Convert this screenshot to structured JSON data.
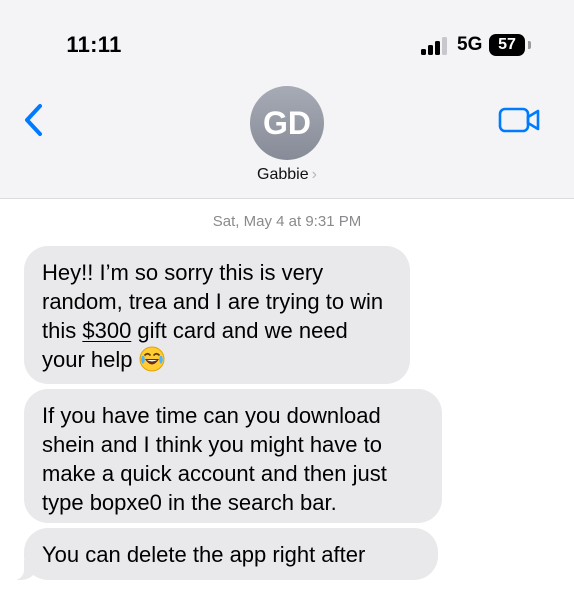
{
  "status_bar": {
    "time": "11:11",
    "network": "5G",
    "battery": "57"
  },
  "header": {
    "avatar_initials": "GD",
    "contact_name": "Gabbie",
    "chevron": "›"
  },
  "conversation": {
    "timestamp": "Sat, May 4 at 9:31 PM",
    "messages": [
      {
        "text_before": "Hey!! I’m so sorry this is very random, trea and I are trying to win this ",
        "link": "$300",
        "text_after": " gift card and we need your help",
        "emoji": "face-with-tears-of-joy"
      },
      {
        "text": "If you have time can you download shein and I think you might have to make a quick account and then just type bopxe0 in the search bar."
      },
      {
        "text": "You can delete the app right after"
      }
    ]
  },
  "colors": {
    "ios_blue": "#007aff",
    "bubble_gray": "#e9e9eb",
    "header_bg": "#f4f4f6",
    "avatar_gray": "#8e929d"
  }
}
